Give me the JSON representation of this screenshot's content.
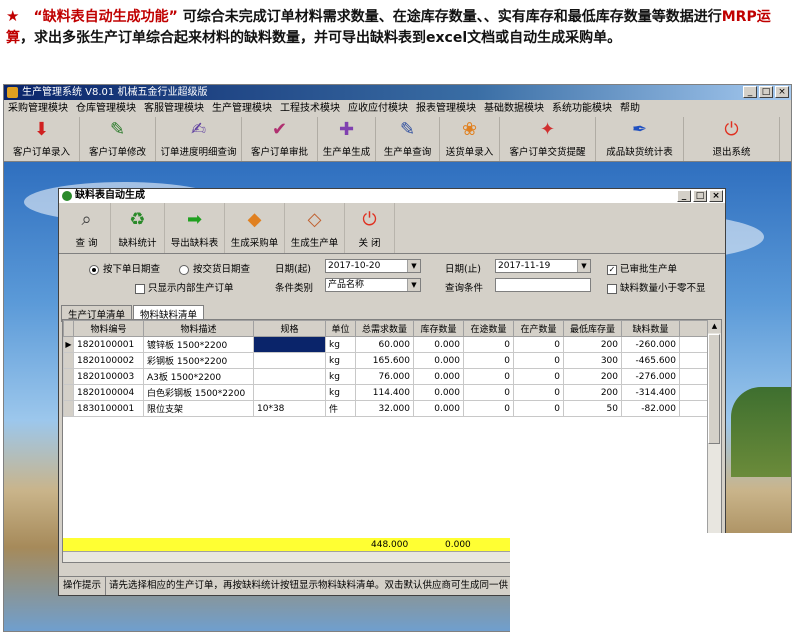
{
  "intro": {
    "star": "★",
    "feature": "“缺料表自动生成功能”",
    "text1": "可综合未完成订单材料需求数量、在途库存数量、、实有库存和最低库存数量等数据进行",
    "mrp": "MRP运算",
    "text2": "，求出多张生产订单综合起来材料的缺料数量，并可导出缺料表到excel文档或自动生成采购单。"
  },
  "app": {
    "title": "生产管理系统  V8.01  机械五金行业超级版",
    "window_controls": [
      "_",
      "□",
      "×"
    ],
    "menu": [
      "采购管理模块",
      "仓库管理模块",
      "客服管理模块",
      "生产管理模块",
      "工程技术模块",
      "应收应付模块",
      "报表管理模块",
      "基础数据模块",
      "系统功能模块",
      "帮助"
    ],
    "toolbar": [
      {
        "label": "客户订单录入",
        "icon": "pdf-icon",
        "glyph": "⬇",
        "color": "#d02020"
      },
      {
        "label": "客户订单修改",
        "icon": "edit-chart-icon",
        "glyph": "✎",
        "color": "#2a7a2a"
      },
      {
        "label": "订单进度明细查询",
        "icon": "pen-icon",
        "glyph": "✍",
        "color": "#6040a0"
      },
      {
        "label": "客户订单审批",
        "icon": "approve-icon",
        "glyph": "✔",
        "color": "#b03070"
      },
      {
        "label": "生产单生成",
        "icon": "generate-icon",
        "glyph": "✚",
        "color": "#8040b0"
      },
      {
        "label": "生产单查询",
        "icon": "query-icon",
        "glyph": "✎",
        "color": "#3050a0"
      },
      {
        "label": "送货单录入",
        "icon": "delivery-icon",
        "glyph": "❀",
        "color": "#e08020"
      },
      {
        "label": "客户订单交货提醒",
        "icon": "reminder-icon",
        "glyph": "✦",
        "color": "#d03030"
      },
      {
        "label": "成品缺货统计表",
        "icon": "stats-icon",
        "glyph": "✒",
        "color": "#2050c0"
      },
      {
        "label": "退出系统",
        "icon": "power-icon",
        "glyph": "⏻",
        "color": "#e03020"
      }
    ]
  },
  "child": {
    "title": "缺料表自动生成",
    "toolbar": [
      {
        "label": "查 询",
        "icon": "magnifier-icon",
        "glyph": "🔍",
        "color": "#404040"
      },
      {
        "label": "缺料统计",
        "icon": "refresh-icon",
        "glyph": "♻",
        "color": "#2a8a2a"
      },
      {
        "label": "导出缺料表",
        "icon": "arrow-right-icon",
        "glyph": "➡",
        "color": "#20a020"
      },
      {
        "label": "生成采购单",
        "icon": "purchase-icon",
        "glyph": "◆",
        "color": "#e08020"
      },
      {
        "label": "生成生产单",
        "icon": "diamond-icon",
        "glyph": "◇",
        "color": "#c06030"
      },
      {
        "label": "关 闭",
        "icon": "power-icon",
        "glyph": "⏻",
        "color": "#e03020"
      }
    ],
    "filters": {
      "radio1": "按下单日期查",
      "radio2": "按交货日期查",
      "date_from_label": "日期(起)",
      "date_from": "2017-10-20",
      "date_to_label": "日期(止)",
      "date_to": "2017-11-19",
      "approved_label": "已审批生产单",
      "internal_label": "只显示内部生产订单",
      "category_label": "条件类别",
      "category_value": "产品名称",
      "query_label": "查询条件",
      "query_value": "",
      "shortage_label": "缺料数量小于零不显"
    },
    "tabs": [
      "生产订单清单",
      "物料缺料清单"
    ],
    "columns": [
      "物料编号",
      "物料描述",
      "规格",
      "单位",
      "总需求数量",
      "库存数量",
      "在途数量",
      "在产数量",
      "最低库存量",
      "缺料数量"
    ],
    "rows": [
      [
        "1820100001",
        "镀锌板 1500*2200",
        "",
        "kg",
        "60.000",
        "0.000",
        "0",
        "0",
        "200",
        "-260.000"
      ],
      [
        "1820100002",
        "彩钢板 1500*2200",
        "",
        "kg",
        "165.600",
        "0.000",
        "0",
        "0",
        "300",
        "-465.600"
      ],
      [
        "1820100003",
        "A3板 1500*2200",
        "",
        "kg",
        "76.000",
        "0.000",
        "0",
        "0",
        "200",
        "-276.000"
      ],
      [
        "1820100004",
        "白色彩钢板 1500*2200",
        "",
        "kg",
        "114.400",
        "0.000",
        "0",
        "0",
        "200",
        "-314.400"
      ],
      [
        "1830100001",
        "限位支架",
        "10*38",
        "件",
        "32.000",
        "0.000",
        "0",
        "0",
        "50",
        "-82.000"
      ]
    ],
    "totals": {
      "total_demand": "448.000",
      "total_stock": "0.000"
    },
    "status": {
      "label": "操作提示",
      "text": "请先选择相应的生产订单，再按缺料统计按钮显示物料缺料清单。双击默认供应商可生成同一供"
    }
  }
}
